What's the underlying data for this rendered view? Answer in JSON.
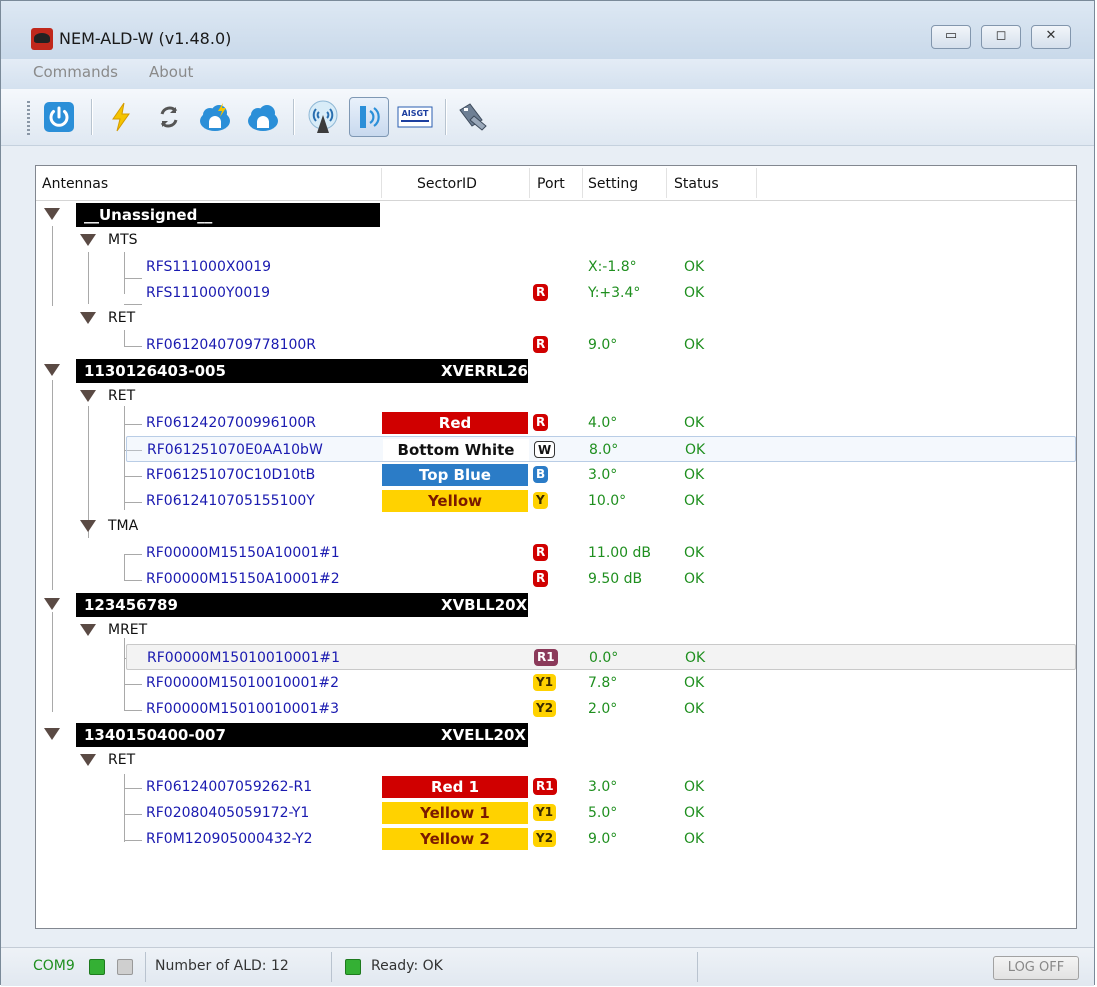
{
  "window": {
    "title": "NEM-ALD-W (v1.48.0)"
  },
  "menu": {
    "commands": "Commands",
    "about": "About"
  },
  "toolbar": {
    "aisgt_label": "AISGT"
  },
  "columns": {
    "antennas": "Antennas",
    "sectorid": "SectorID",
    "port": "Port",
    "setting": "Setting",
    "status": "Status"
  },
  "colors": {
    "red": "#d00000",
    "yellow": "#ffd200",
    "blue": "#2b7cc7",
    "ok_green": "#1f8f1f",
    "link_blue": "#1a1ab0",
    "port_r1": "#8b3a5a"
  },
  "groups": [
    {
      "name": "__Unassigned__",
      "sector": "",
      "subgroups": [
        {
          "name": "MTS",
          "devices": [
            {
              "name": "RFS111000X0019",
              "sector": "",
              "port": "",
              "setting": "X:-1.8°",
              "status": "OK"
            },
            {
              "name": "RFS111000Y0019",
              "sector": "",
              "port": "R",
              "setting": "Y:+3.4°",
              "status": "OK"
            }
          ]
        },
        {
          "name": "RET",
          "devices": [
            {
              "name": "RF0612040709778100R",
              "sector": "",
              "port": "R",
              "setting": "9.0°",
              "status": "OK"
            }
          ]
        }
      ]
    },
    {
      "name": "1130126403-005",
      "sector": "XVERRL26",
      "subgroups": [
        {
          "name": "RET",
          "devices": [
            {
              "name": "RF0612420700996100R",
              "sector": "Red",
              "port": "R",
              "setting": "4.0°",
              "status": "OK"
            },
            {
              "name": "RF061251070E0AA10bW",
              "sector": "Bottom White",
              "port": "W",
              "setting": "8.0°",
              "status": "OK"
            },
            {
              "name": "RF061251070C10D10tB",
              "sector": "Top Blue",
              "port": "B",
              "setting": "3.0°",
              "status": "OK"
            },
            {
              "name": "RF0612410705155100Y",
              "sector": "Yellow",
              "port": "Y",
              "setting": "10.0°",
              "status": "OK"
            }
          ]
        },
        {
          "name": "TMA",
          "devices": [
            {
              "name": "RF00000M15150A10001#1",
              "sector": "",
              "port": "R",
              "setting": "11.00 dB",
              "status": "OK"
            },
            {
              "name": "RF00000M15150A10001#2",
              "sector": "",
              "port": "R",
              "setting": "9.50 dB",
              "status": "OK"
            }
          ]
        }
      ]
    },
    {
      "name": "123456789",
      "sector": "XVBLL20X",
      "subgroups": [
        {
          "name": "MRET",
          "devices": [
            {
              "name": "RF00000M15010010001#1",
              "sector": "",
              "port": "R1",
              "setting": "0.0°",
              "status": "OK"
            },
            {
              "name": "RF00000M15010010001#2",
              "sector": "",
              "port": "Y1",
              "setting": "7.8°",
              "status": "OK"
            },
            {
              "name": "RF00000M15010010001#3",
              "sector": "",
              "port": "Y2",
              "setting": "2.0°",
              "status": "OK"
            }
          ]
        }
      ]
    },
    {
      "name": "1340150400-007",
      "sector": "XVELL20X",
      "subgroups": [
        {
          "name": "RET",
          "devices": [
            {
              "name": "RF06124007059262-R1",
              "sector": "Red 1",
              "port": "R1",
              "setting": "3.0°",
              "status": "OK"
            },
            {
              "name": "RF02080405059172-Y1",
              "sector": "Yellow 1",
              "port": "Y1",
              "setting": "5.0°",
              "status": "OK"
            },
            {
              "name": "RF0M120905000432-Y2",
              "sector": "Yellow 2",
              "port": "Y2",
              "setting": "9.0°",
              "status": "OK"
            }
          ]
        }
      ]
    }
  ],
  "statusbar": {
    "com": "COM9",
    "ald_count": "Number of ALD: 12",
    "ready": "Ready: OK",
    "logoff": "LOG OFF"
  }
}
